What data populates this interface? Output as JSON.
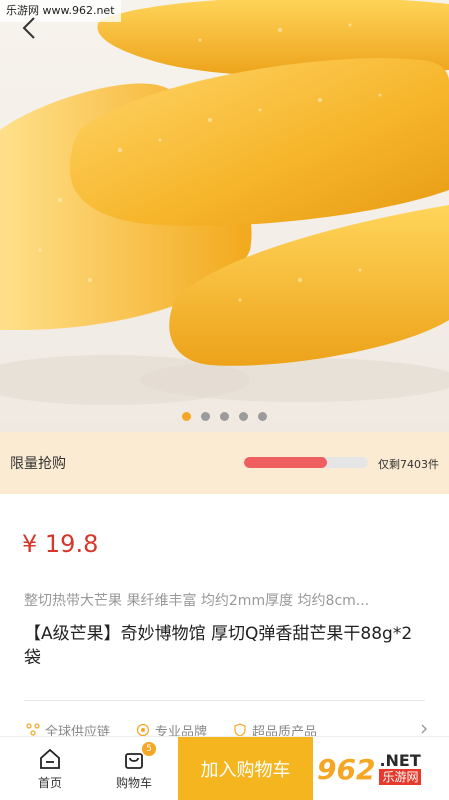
{
  "watermark_top": "乐游网 www.962.net",
  "pager": {
    "count": 5,
    "active_index": 0
  },
  "flash_sale": {
    "title": "限量抢购",
    "progress_fraction": 0.67,
    "remaining_text": "仅剩7403件"
  },
  "product": {
    "price": "¥ 19.8",
    "subtitle": "整切热带大芒果 果纤维丰富 均约2mm厚度 均约8cm...",
    "title": "【A级芒果】奇妙博物馆 厚切Q弹香甜芒果干88g*2袋"
  },
  "features": [
    {
      "icon": "globe-supply-icon",
      "label": "全球供应链"
    },
    {
      "icon": "brand-badge-icon",
      "label": "专业品牌"
    },
    {
      "icon": "shield-quality-icon",
      "label": "超品质产品"
    }
  ],
  "bottom_bar": {
    "home_label": "首页",
    "cart_label": "购物车",
    "cart_badge": "5",
    "add_to_cart_label": "加入购物车"
  },
  "watermark_logo": {
    "big": "962",
    "net": ".NET",
    "cn": "乐游网"
  },
  "colors": {
    "accent": "#f5a623",
    "price_red": "#d9362a",
    "progress_red": "#f05f5f",
    "flash_bg": "#fcebd3",
    "cart_button": "#f5b51f"
  }
}
